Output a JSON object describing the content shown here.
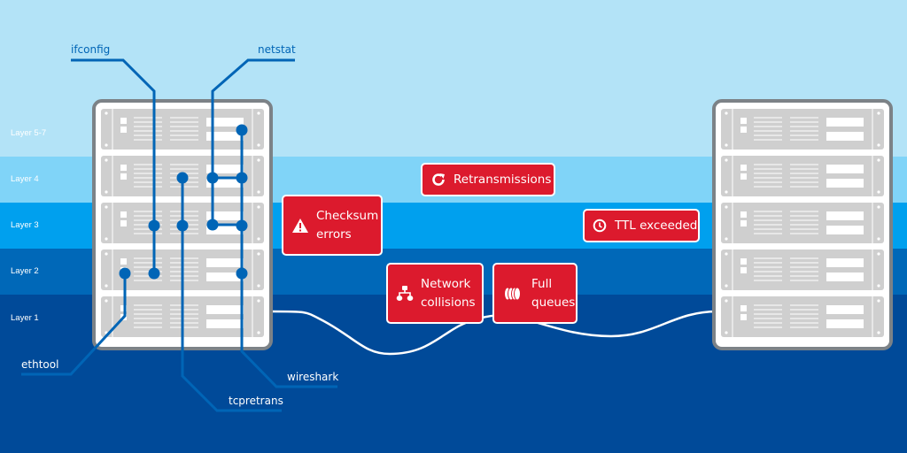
{
  "colors": {
    "layer_5_7": "#b3e3f7",
    "layer_4": "#80d4f8",
    "layer_3": "#00a0ee",
    "layer_2": "#0068b8",
    "layer_1": "#004a99",
    "probe": "#0065b6",
    "alert_bg": "#dc1a2d",
    "server_frame": "#7c8287",
    "server_unit": "#cfcfcf",
    "cable": "#ffffff"
  },
  "layers": [
    {
      "label": "Layer 5-7"
    },
    {
      "label": "Layer 4"
    },
    {
      "label": "Layer 3"
    },
    {
      "label": "Layer 2"
    },
    {
      "label": "Layer 1"
    }
  ],
  "tools": {
    "ifconfig": "ifconfig",
    "netstat": "netstat",
    "ethtool": "ethtool",
    "tcpretrans": "tcpretrans",
    "wireshark": "wireshark"
  },
  "alerts": {
    "retransmissions": {
      "label": "Retransmissions",
      "icon": "refresh-icon"
    },
    "checksum": {
      "line1": "Checksum",
      "line2": "errors",
      "icon": "warning-icon"
    },
    "ttl": {
      "label": "TTL exceeded",
      "icon": "clock-icon"
    },
    "collisions": {
      "line1": "Network",
      "line2": "collisions",
      "icon": "network-icon"
    },
    "queues": {
      "line1": "Full",
      "line2": "queues",
      "icon": "queue-icon"
    }
  },
  "servers": [
    {
      "name": "left-server",
      "units": 5
    },
    {
      "name": "right-server",
      "units": 5
    }
  ]
}
